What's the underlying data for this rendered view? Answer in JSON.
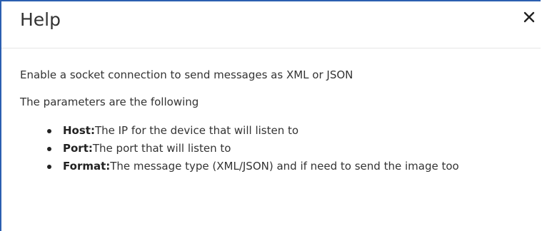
{
  "dialog": {
    "title": "Help",
    "close_label": "×"
  },
  "content": {
    "intro": "Enable a socket connection to send messages as XML or JSON",
    "params_intro": "The parameters are the following",
    "params": [
      {
        "key": "Host:",
        "desc": "The IP for the device that will listen to"
      },
      {
        "key": "Port:",
        "desc": "The port that will listen to"
      },
      {
        "key": "Format:",
        "desc": "The message type (XML/JSON) and if need to send the image too"
      }
    ]
  },
  "icons": {
    "close": "close-icon"
  },
  "colors": {
    "frame_border": "#2b5fb0",
    "text": "#333333",
    "divider": "#e5e5e5"
  }
}
